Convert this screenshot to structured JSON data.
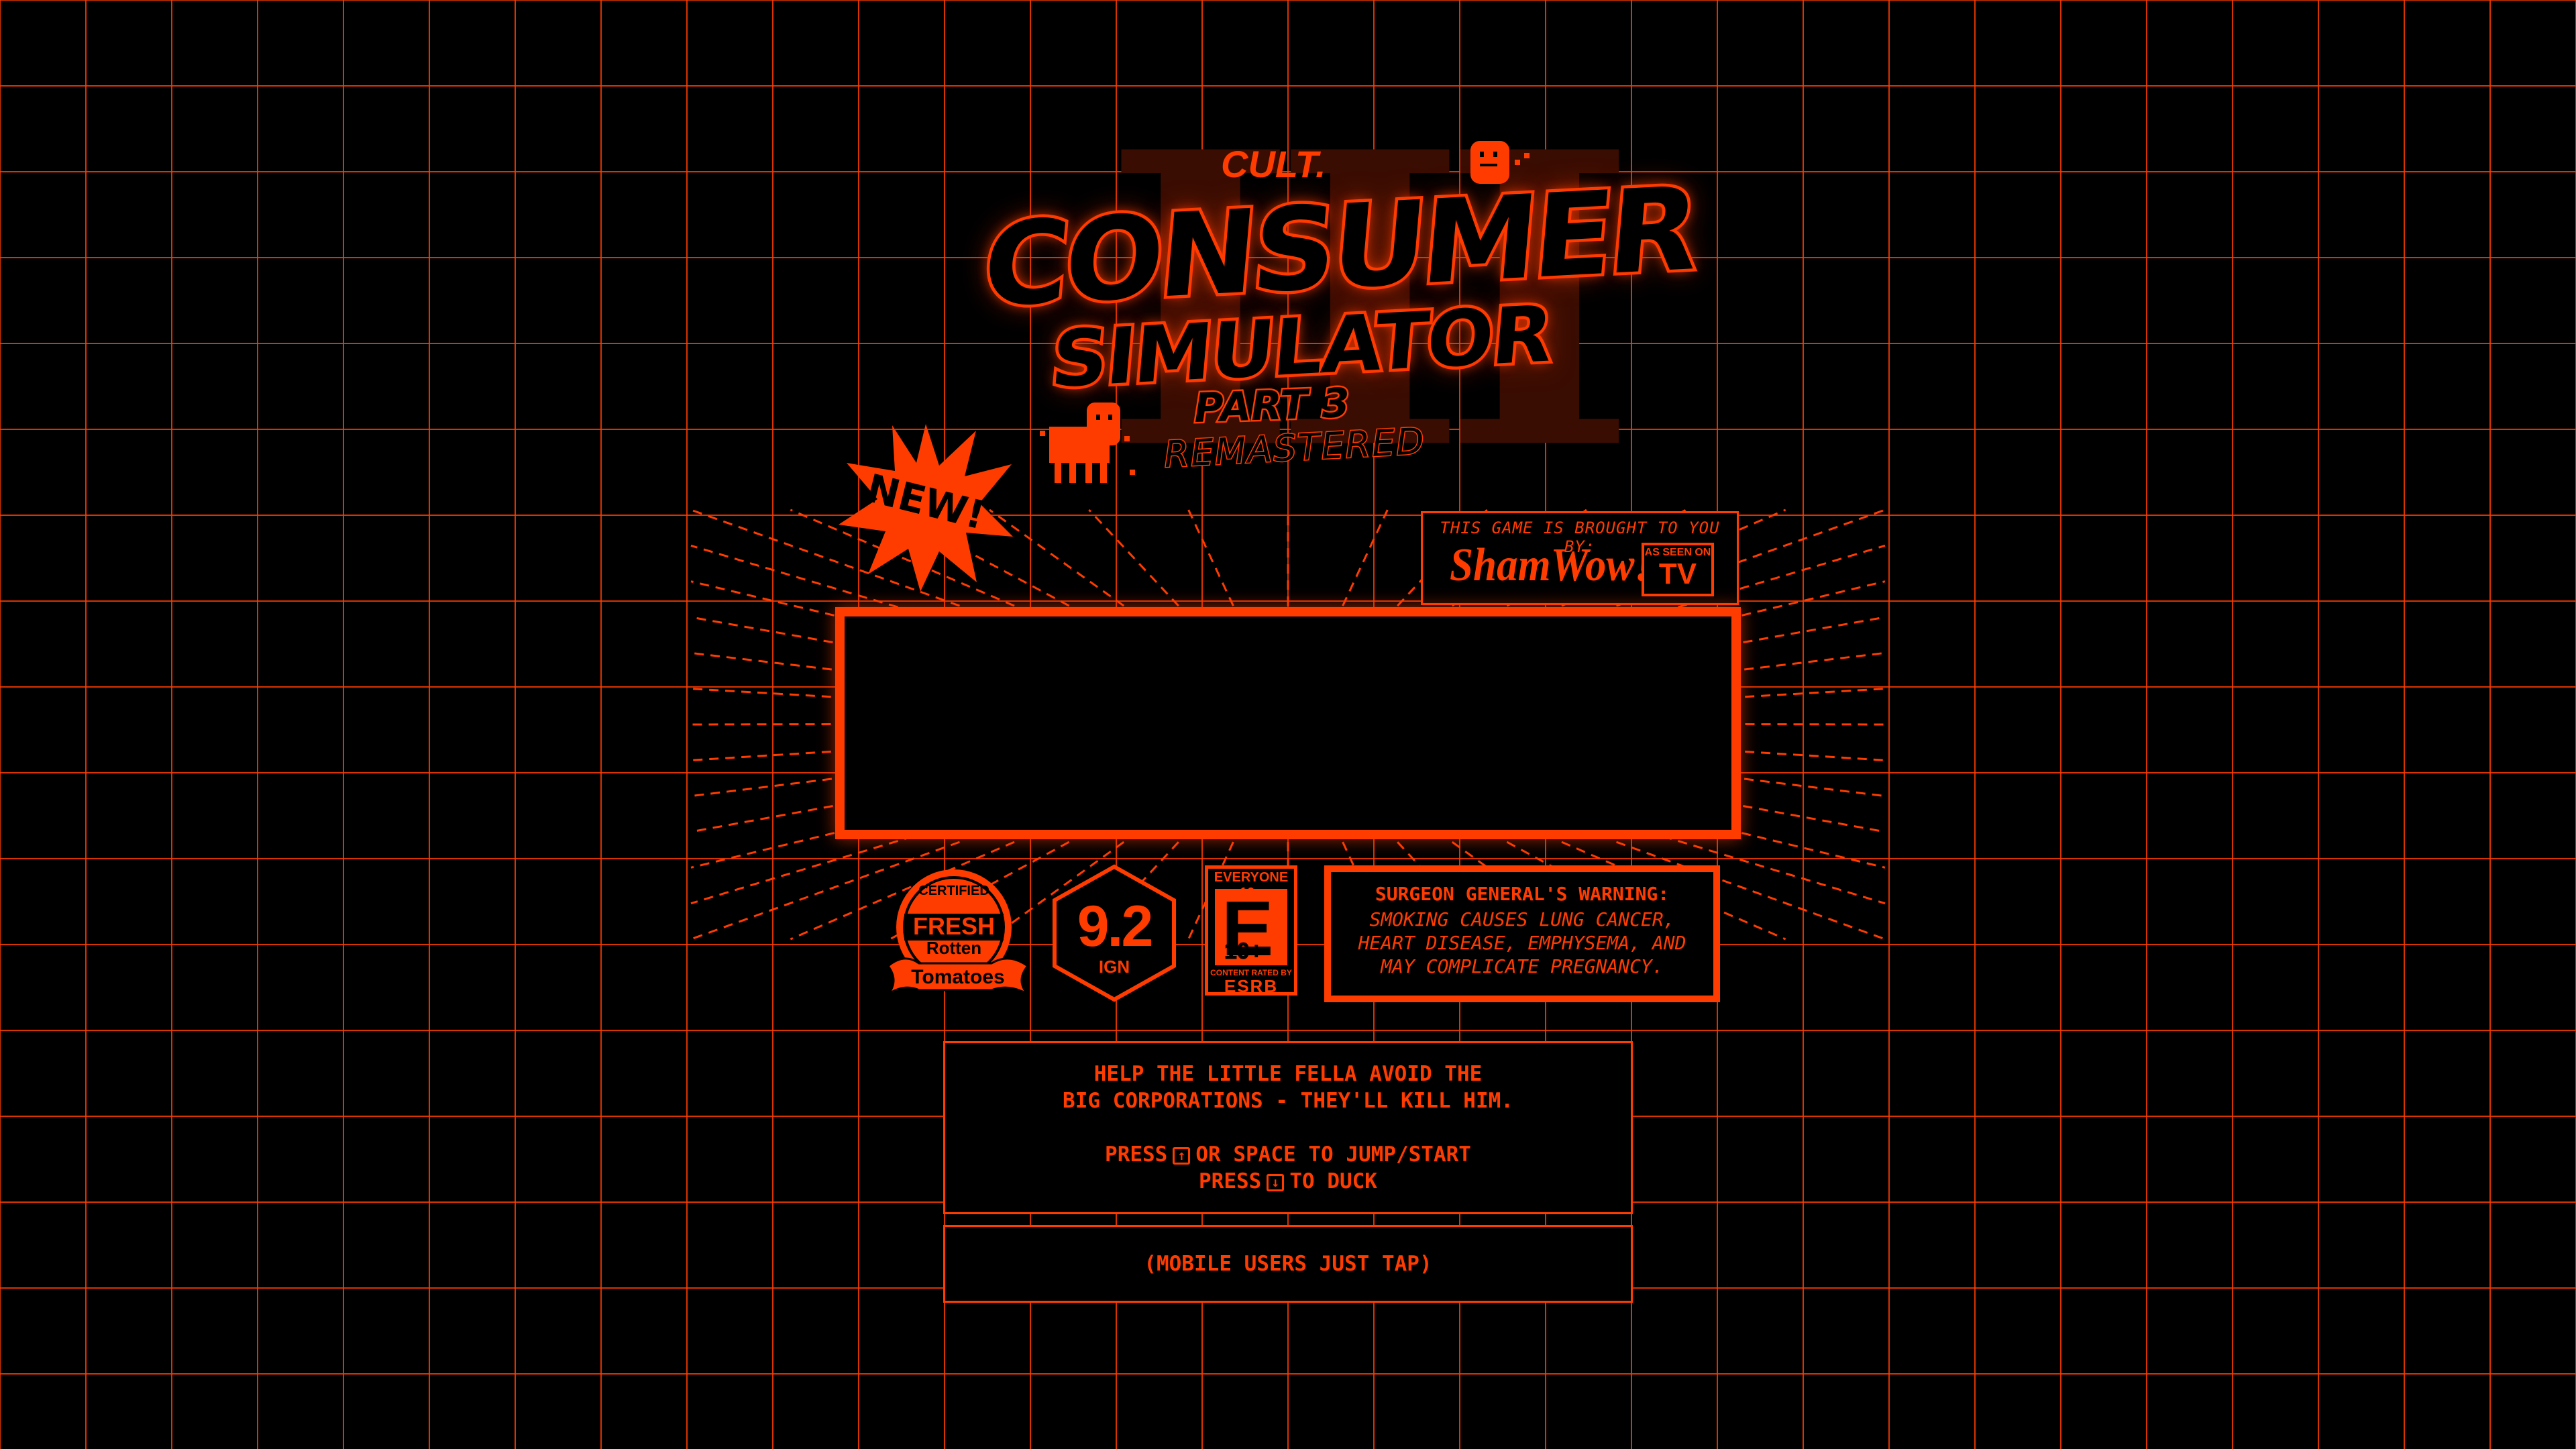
{
  "logo": {
    "brand": "CULT.",
    "title_line1": "CONSUMER",
    "title_line2": "SIMULATOR",
    "roman_numeral": "III",
    "part": "PART 3",
    "edition": "REMASTERED"
  },
  "new_badge": "NEW!",
  "sponsor": {
    "caption": "THIS GAME IS BROUGHT TO YOU BY:",
    "brand_logo": "ShamWow!",
    "tv_badge_top": "AS SEEN ON",
    "tv_badge_main": "TV"
  },
  "ratings": {
    "rotten_tomatoes": {
      "certified": "CERTIFIED",
      "fresh": "FRESH",
      "rotten": "Rotten",
      "tomatoes": "Tomatoes"
    },
    "ign": {
      "score": "9.2",
      "brand": "IGN"
    },
    "esrb": {
      "top": "EVERYONE 10+",
      "letter": "E",
      "age": "10+",
      "content": "CONTENT RATED BY",
      "brand": "ESRB"
    }
  },
  "warning": {
    "heading": "SURGEON GENERAL'S WARNING:",
    "body": "SMOKING CAUSES LUNG CANCER, HEART DISEASE, EMPHYSEMA, AND MAY COMPLICATE PREGNANCY."
  },
  "instructions": {
    "line1": "HELP THE LITTLE FELLA AVOID THE",
    "line2": "BIG CORPORATIONS - THEY'LL KILL HIM.",
    "jump_prefix": "PRESS",
    "jump_key": "↑",
    "jump_suffix": "OR SPACE TO JUMP/START",
    "duck_prefix": "PRESS",
    "duck_key": "↓",
    "duck_suffix": "TO DUCK"
  },
  "mobile_hint": "(MOBILE USERS JUST TAP)",
  "colors": {
    "accent": "#ff3c00",
    "background": "#000000",
    "roman_shadow": "#3a0d02"
  }
}
